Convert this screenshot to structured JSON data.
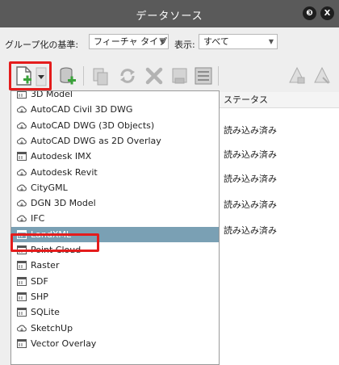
{
  "window": {
    "title": "データソース",
    "buttons": [
      "help-icon",
      "close-icon"
    ],
    "help_glyph": "❸",
    "close_glyph": "X"
  },
  "filter": {
    "group_label": "グループ化の基準:",
    "group_value": "フィーチャ タイプ",
    "display_label": "表示:",
    "display_value": "すべて"
  },
  "toolbar": {
    "icons": [
      "new-data-source-icon",
      "dropdown-arrow-icon",
      "add-database-icon",
      "copy-icon",
      "refresh-icon",
      "delete-icon",
      "export-icon",
      "properties-icon",
      "style-icon",
      "style-alt-icon"
    ]
  },
  "grid": {
    "status_header": "ステータス",
    "rows": [
      "読み込み済み",
      "読み込み済み",
      "読み込み済み",
      "読み込み済み",
      "読み込み済み"
    ]
  },
  "menu": {
    "items": [
      {
        "label": "3D Model",
        "icon": "grid-icon"
      },
      {
        "label": "AutoCAD Civil 3D DWG",
        "icon": "cloud-icon"
      },
      {
        "label": "AutoCAD DWG (3D Objects)",
        "icon": "cloud-icon"
      },
      {
        "label": "AutoCAD DWG as 2D Overlay",
        "icon": "cloud-icon"
      },
      {
        "label": "Autodesk IMX",
        "icon": "grid-icon"
      },
      {
        "label": "Autodesk Revit",
        "icon": "cloud-icon"
      },
      {
        "label": "CityGML",
        "icon": "cloud-icon"
      },
      {
        "label": "DGN 3D Model",
        "icon": "cloud-icon"
      },
      {
        "label": "IFC",
        "icon": "cloud-icon"
      },
      {
        "label": "LandXML",
        "icon": "grid-icon",
        "selected": true
      },
      {
        "label": "Point Cloud",
        "icon": "grid-icon"
      },
      {
        "label": "Raster",
        "icon": "grid-icon"
      },
      {
        "label": "SDF",
        "icon": "grid-icon"
      },
      {
        "label": "SHP",
        "icon": "grid-icon"
      },
      {
        "label": "SQLite",
        "icon": "grid-icon"
      },
      {
        "label": "SketchUp",
        "icon": "cloud-icon"
      },
      {
        "label": "Vector Overlay",
        "icon": "grid-icon"
      }
    ]
  },
  "colors": {
    "titlebar": "#5a5a5a",
    "highlight_box": "#e41c1c",
    "selected_row": "#7aa0b4",
    "add_green": "#3aa23a"
  }
}
